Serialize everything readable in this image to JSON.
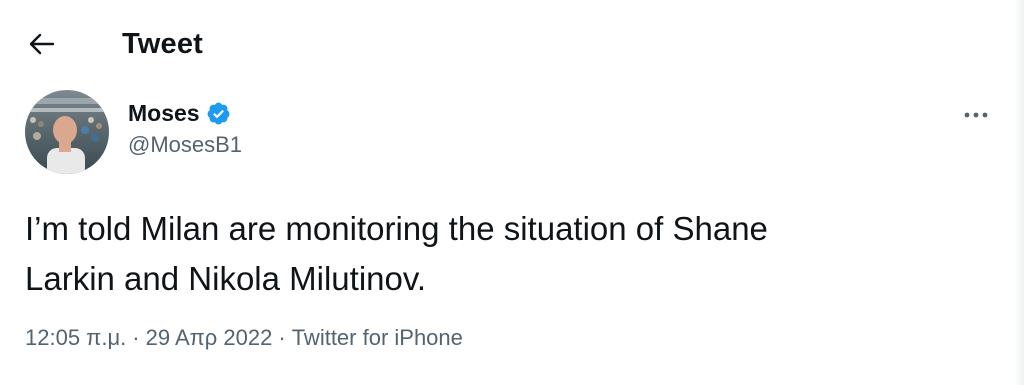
{
  "header": {
    "title": "Tweet",
    "back_icon": "arrow-left-icon"
  },
  "tweet": {
    "author": {
      "display_name": "Moses",
      "handle": "@MosesB1",
      "verified": true,
      "verified_color": "#1d9bf0"
    },
    "more_icon": "more-horizontal-icon",
    "text": "I’m told Milan are monitoring the situation of Shane\nLarkin and Nikola Milutinov.",
    "time": "12:05 π.μ.",
    "date": "29 Απρ 2022",
    "separator": "·",
    "source": "Twitter for iPhone"
  },
  "colors": {
    "text_primary": "#0f1419",
    "text_secondary": "#536471",
    "accent": "#1d9bf0"
  }
}
